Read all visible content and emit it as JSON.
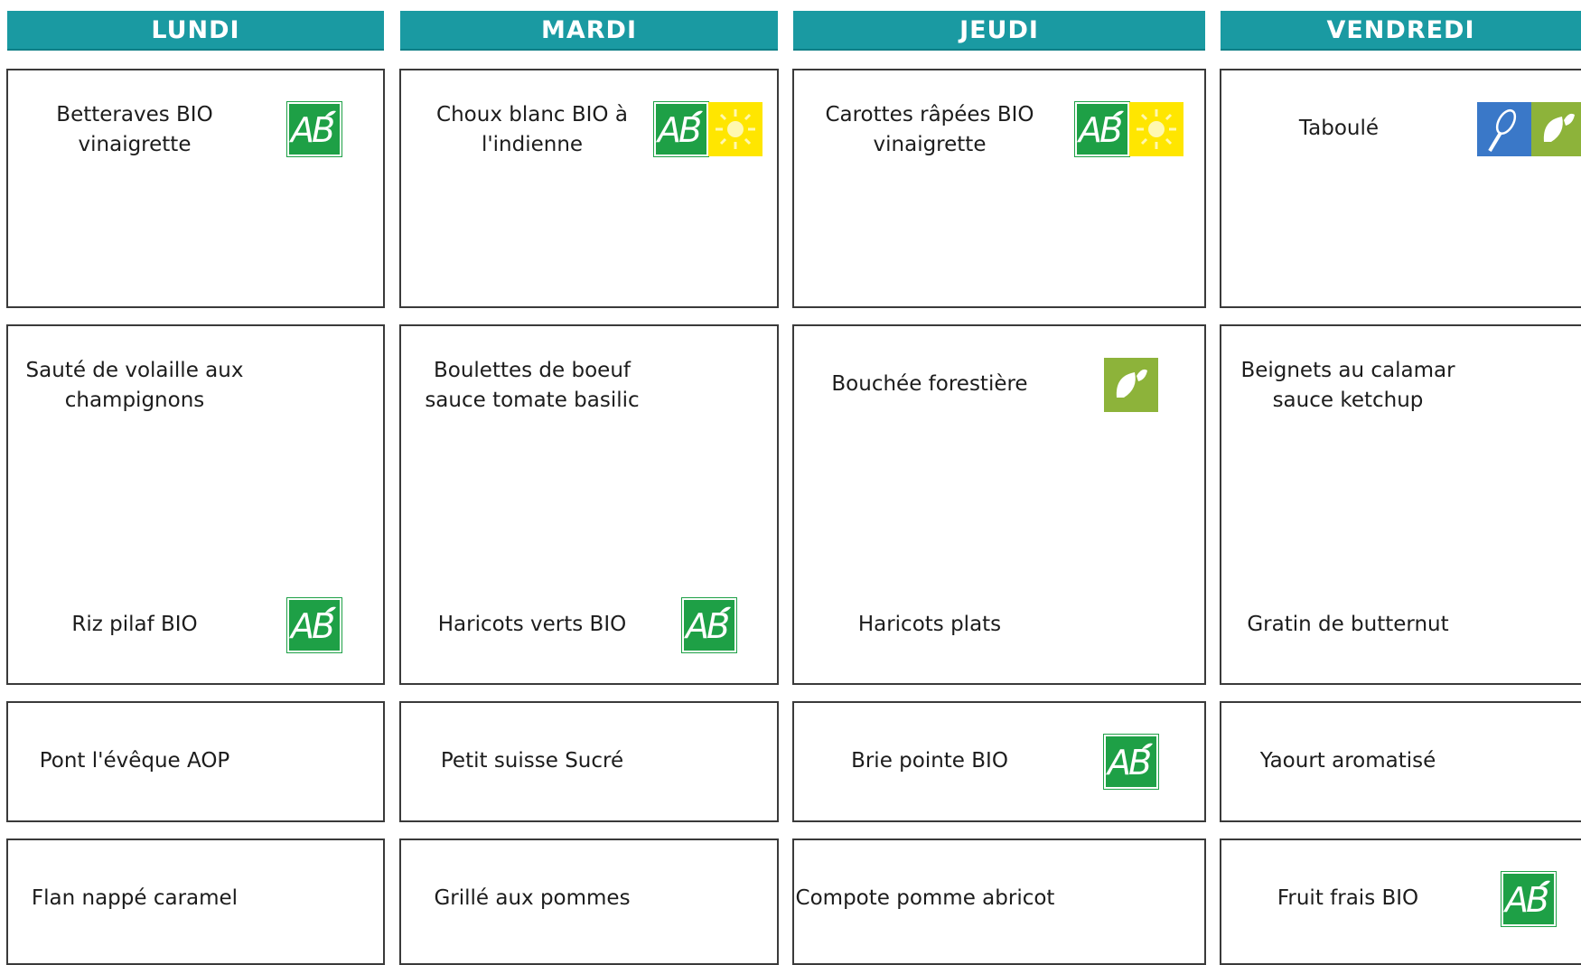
{
  "days": [
    "LUNDI",
    "MARDI",
    "JEUDI",
    "VENDREDI"
  ],
  "lundi": {
    "entree": [
      "Betteraves BIO",
      "vinaigrette"
    ],
    "plat": [
      "Sauté de volaille aux",
      "champignons"
    ],
    "accompagnement": "Riz pilaf BIO",
    "fromage": "Pont l'évêque AOP",
    "dessert": "Flan nappé caramel"
  },
  "mardi": {
    "entree": [
      "Choux blanc BIO à",
      "l'indienne"
    ],
    "plat": [
      "Boulettes de boeuf",
      "sauce tomate basilic"
    ],
    "accompagnement": "Haricots verts BIO",
    "fromage": "Petit suisse Sucré",
    "dessert": "Grillé aux pommes"
  },
  "jeudi": {
    "entree": [
      "Carottes râpées BIO",
      "vinaigrette"
    ],
    "plat": "Bouchée forestière",
    "accompagnement": "Haricots plats",
    "fromage": "Brie pointe BIO",
    "dessert": "Compote pomme abricot"
  },
  "vendredi": {
    "entree": "Taboulé",
    "plat": [
      "Beignets au calamar",
      "sauce ketchup"
    ],
    "accompagnement": "Gratin de butternut",
    "fromage": "Yaourt aromatisé",
    "dessert": "Fruit frais BIO"
  },
  "badges": {
    "bio": "AB",
    "icons": [
      "ab-bio-icon",
      "sun-seasonal-icon",
      "leaf-vegetarian-icon",
      "whisk-homemade-icon"
    ]
  },
  "colors": {
    "header": "#1a9aa2",
    "bio_green": "#1ea046",
    "sun_yellow": "#ffe600",
    "leaf_green": "#8db33a",
    "whisk_blue": "#3a78c8"
  }
}
